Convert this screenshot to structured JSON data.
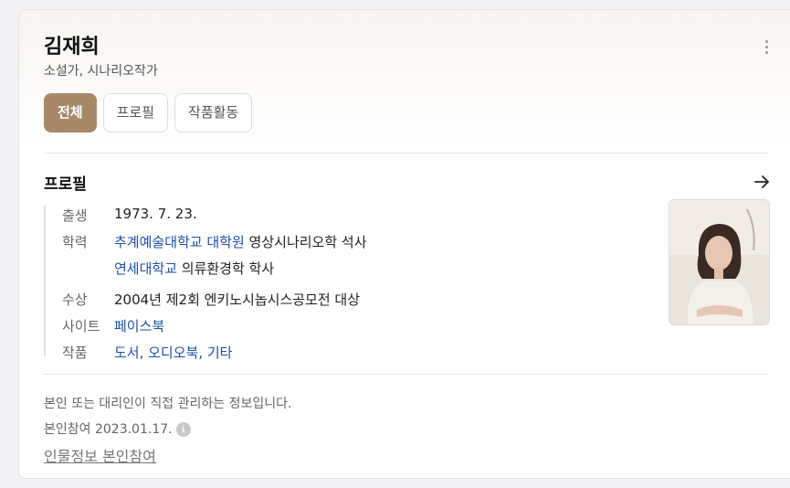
{
  "person": {
    "name": "김재희",
    "roles": "소설가, 시나리오작가"
  },
  "tabs": [
    {
      "label": "전체",
      "active": true
    },
    {
      "label": "프로필",
      "active": false
    },
    {
      "label": "작품활동",
      "active": false
    }
  ],
  "profile": {
    "section_title": "프로필",
    "birth": {
      "label": "출생",
      "value": "1973. 7. 23."
    },
    "education": {
      "label": "학력",
      "line1": {
        "link": "추계예술대학교 대학원",
        "rest": " 영상시나리오학 석사"
      },
      "line2": {
        "link": "연세대학교",
        "rest": " 의류환경학 학사"
      }
    },
    "award": {
      "label": "수상",
      "value": "2004년 제2회 엔키노시놉시스공모전 대상"
    },
    "site": {
      "label": "사이트",
      "value": "페이스북"
    },
    "works": {
      "label": "작품",
      "value": "도서, 오디오북, 기타"
    }
  },
  "footer": {
    "notice": "본인 또는 대리인이 직접 관리하는 정보입니다.",
    "claimed": "본인참여 2023.01.17.",
    "claim_link": "인물정보 본인참여"
  },
  "colors": {
    "accent": "#a78869",
    "link": "#1e4fa8"
  }
}
